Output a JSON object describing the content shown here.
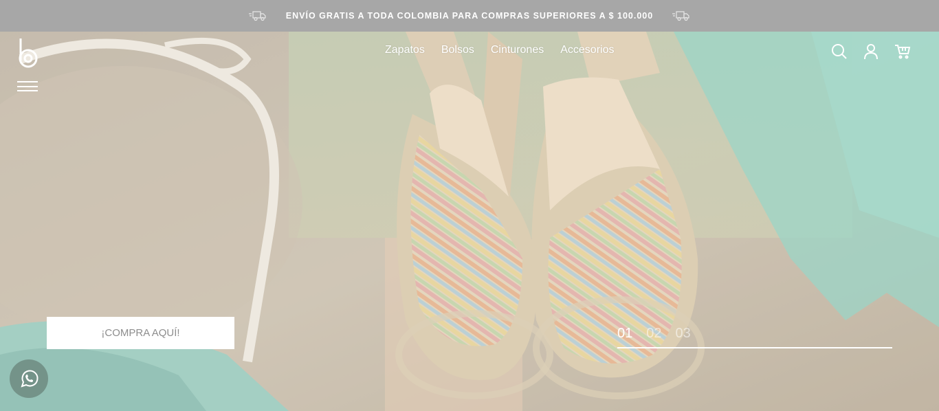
{
  "announcement": {
    "text": "ENVÍO GRATIS A TODA COLOMBIA PARA COMPRAS SUPERIORES A $ 100.000",
    "left_icon": "truck-icon",
    "right_icon": "truck-icon"
  },
  "header": {
    "logo_icon": "brand-logo-b",
    "menu_icon": "hamburger-icon",
    "nav": [
      {
        "label": "Zapatos"
      },
      {
        "label": "Bolsos"
      },
      {
        "label": "Cinturones"
      },
      {
        "label": "Accesorios"
      }
    ],
    "icons": [
      "search-icon",
      "user-icon",
      "cart-icon"
    ]
  },
  "hero": {
    "cta_label": "¡COMPRA AQUÍ!",
    "slides": [
      "01",
      "02",
      "03"
    ],
    "active_slide": 0
  },
  "floating": {
    "icon": "whatsapp-icon"
  },
  "colors": {
    "topbar_bg": "#a7a7a7",
    "cta_bg": "#ffffff",
    "cta_text": "#8d8d8d",
    "nav_text": "#ffffff"
  }
}
